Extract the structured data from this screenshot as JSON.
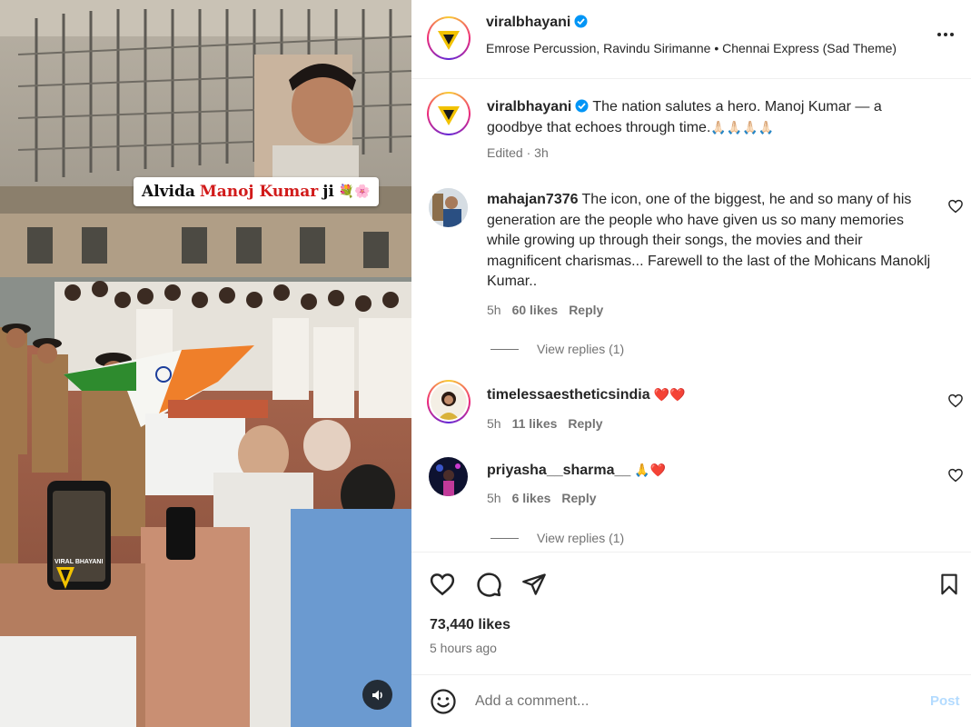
{
  "media": {
    "overlay_prefix": "Alvida",
    "overlay_name": "Manoj Kumar",
    "overlay_suffix": "ji",
    "overlay_emoji": "💐🌸",
    "watermark": "VIRAL BHAYANI",
    "sound_icon": "speaker-icon"
  },
  "header": {
    "username": "viralbhayani",
    "verified": true,
    "music": "Emrose Percussion, Ravindu Sirimanne • Chennai Express (Sad Theme)",
    "more_icon": "more-horizontal-icon"
  },
  "caption": {
    "username": "viralbhayani",
    "text": "The nation salutes a hero. Manoj Kumar — a goodbye that echoes through time.",
    "emojis": "🙏🏻🙏🏻🙏🏻🙏🏻",
    "edited": "Edited",
    "age": "3h"
  },
  "comments": [
    {
      "username": "mahajan7376",
      "text": "The icon, one of the biggest, he and so many of his generation are the people who have given us so many memories while growing up through their songs, the movies and their magnificent charismas... Farewell to the last of the Mohicans Manoklj Kumar..",
      "age": "5h",
      "likes": "60 likes",
      "reply": "Reply",
      "view_replies": "View replies (1)"
    },
    {
      "username": "timelessaestheticsindia",
      "text": "",
      "emojis": "❤️❤️",
      "age": "5h",
      "likes": "11 likes",
      "reply": "Reply"
    },
    {
      "username": "priyasha__sharma__",
      "text": "",
      "emojis": "🙏❤️",
      "age": "5h",
      "likes": "6 likes",
      "reply": "Reply",
      "view_replies": "View replies (1)"
    }
  ],
  "actions": {
    "like_icon": "heart-icon",
    "comment_icon": "comment-icon",
    "share_icon": "paper-plane-icon",
    "save_icon": "bookmark-icon",
    "likes": "73,440 likes",
    "time": "5 hours ago"
  },
  "add_comment": {
    "placeholder": "Add a comment...",
    "post": "Post",
    "emoji_icon": "smiley-icon"
  }
}
